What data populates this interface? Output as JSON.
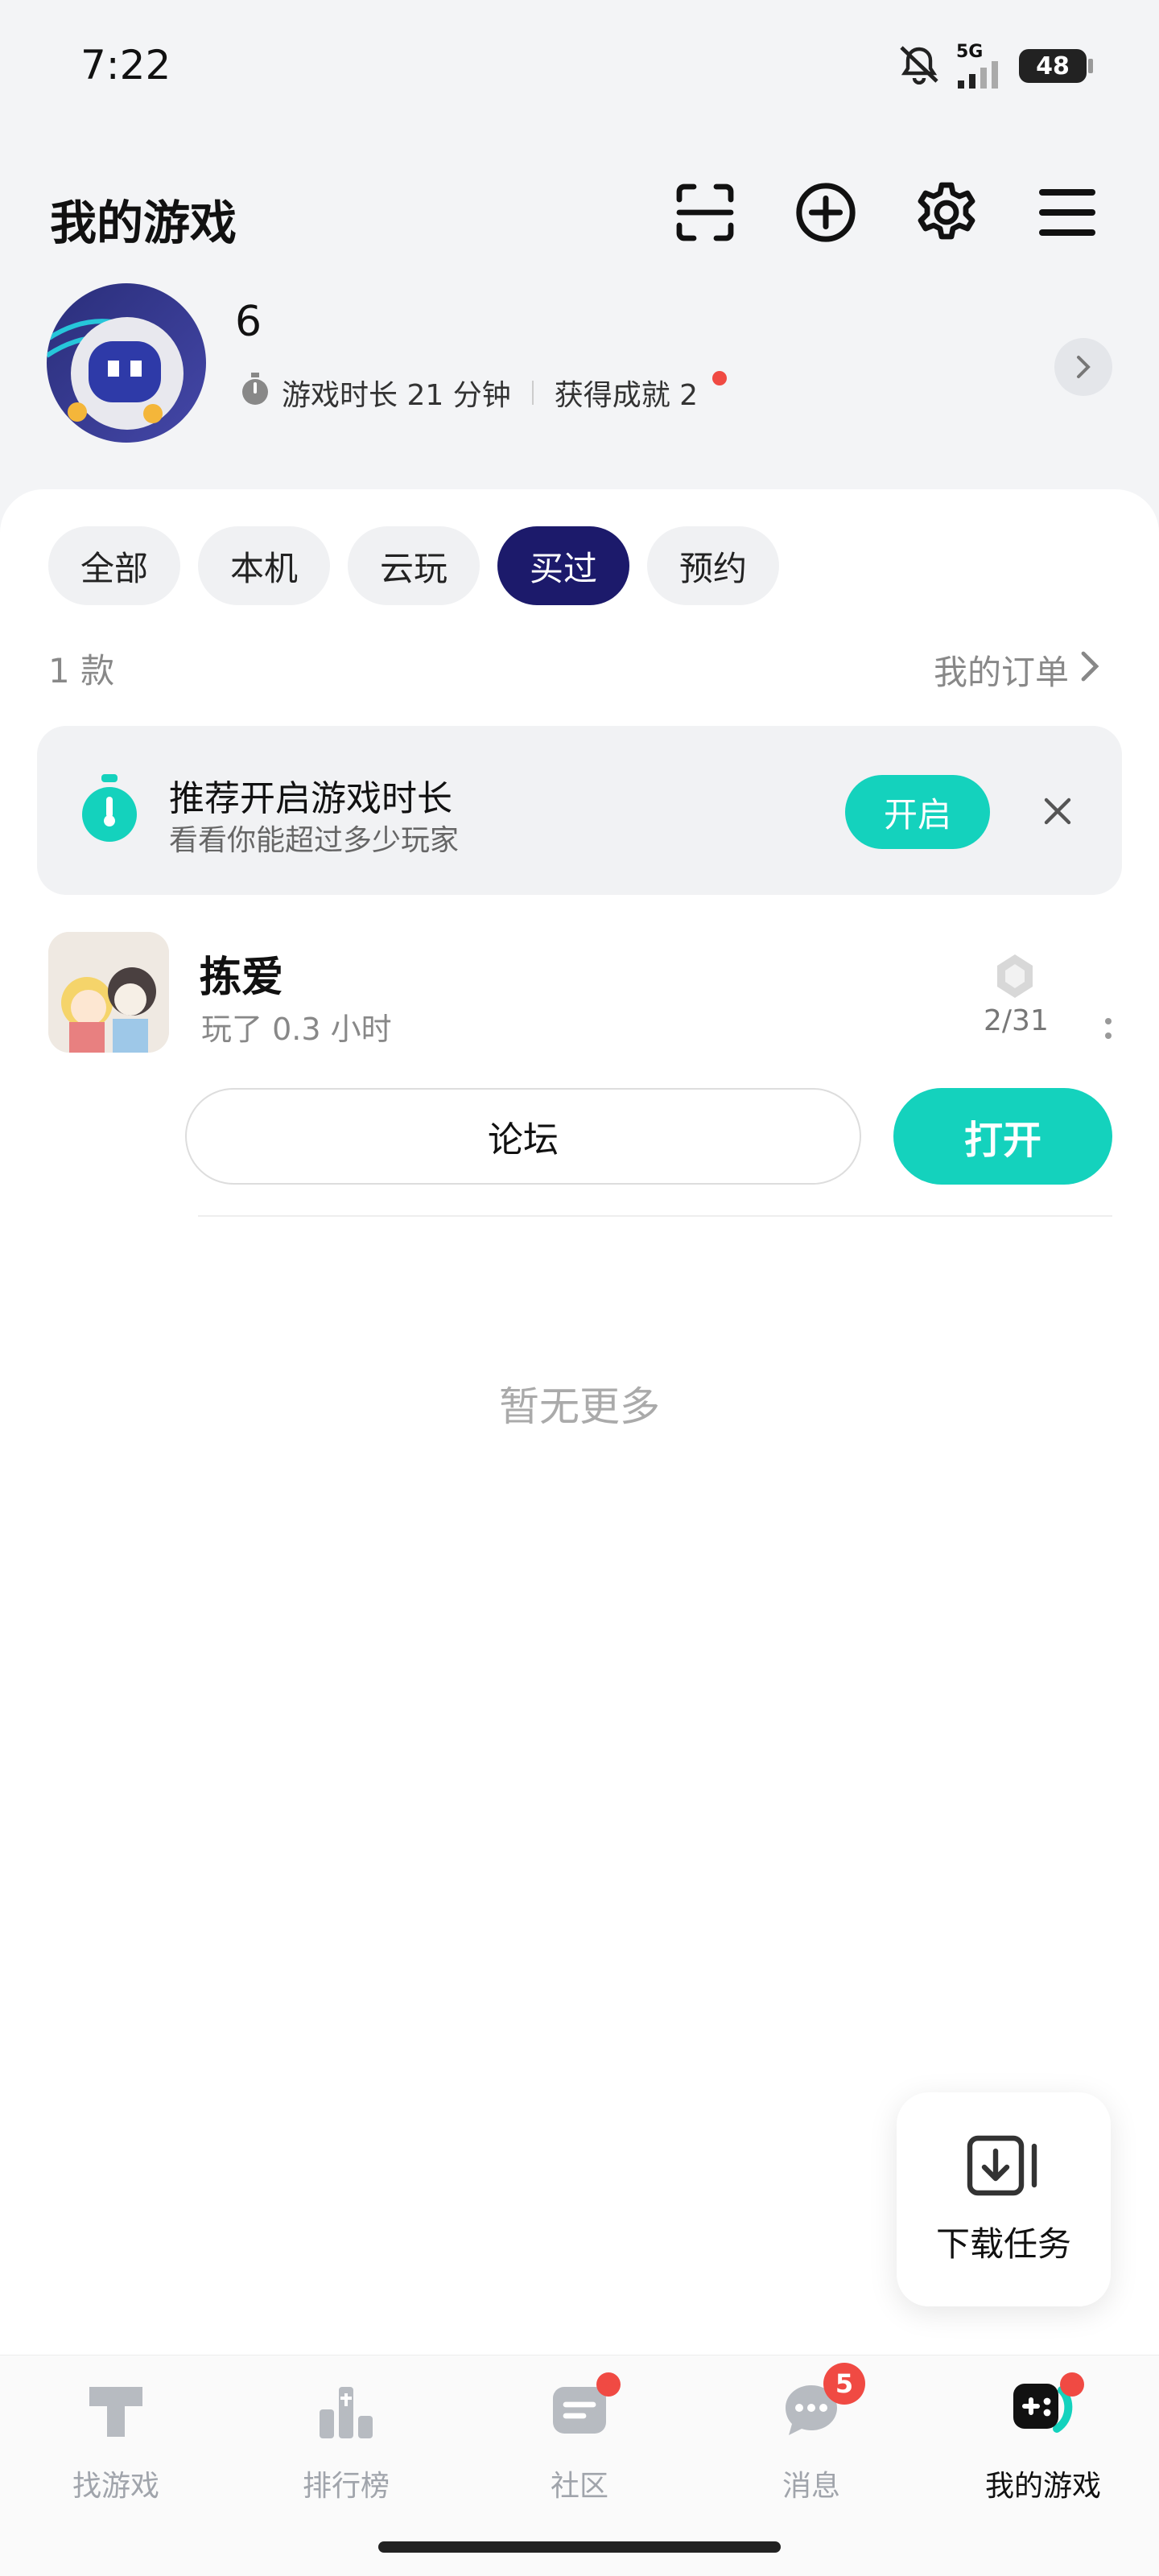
{
  "status_bar": {
    "time": "7:22",
    "network": "5G",
    "battery": "48"
  },
  "header": {
    "title": "我的游戏"
  },
  "profile": {
    "name": "6",
    "playtime_label": "游戏时长 21 分钟",
    "achievements_label": "获得成就 2"
  },
  "filters": [
    {
      "label": "全部",
      "active": false
    },
    {
      "label": "本机",
      "active": false
    },
    {
      "label": "云玩",
      "active": false
    },
    {
      "label": "买过",
      "active": true
    },
    {
      "label": "预约",
      "active": false
    }
  ],
  "list": {
    "count": "1 款",
    "orders_link": "我的订单"
  },
  "promo": {
    "title": "推荐开启游戏时长",
    "subtitle": "看看你能超过多少玩家",
    "button": "开启"
  },
  "game": {
    "name": "拣爱",
    "played": "玩了 0.3 小时",
    "achievements": "2/31",
    "forum_button": "论坛",
    "open_button": "打开"
  },
  "empty_text": "暂无更多",
  "download_fab": {
    "label": "下载任务"
  },
  "bottom_nav": [
    {
      "label": "找游戏",
      "icon": "find-game-icon"
    },
    {
      "label": "排行榜",
      "icon": "ranking-icon"
    },
    {
      "label": "社区",
      "icon": "community-icon"
    },
    {
      "label": "消息",
      "icon": "message-icon",
      "badge": "5"
    },
    {
      "label": "我的游戏",
      "icon": "my-games-icon"
    }
  ],
  "colors": {
    "accent": "#14d2bd",
    "active_filter": "#1c1a6b",
    "badge": "#f04a43"
  }
}
